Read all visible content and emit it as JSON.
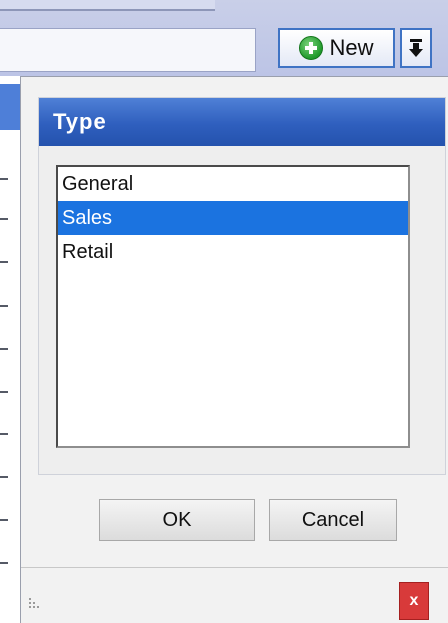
{
  "toolbar": {
    "new_label": "New",
    "new_icon": "plus-circle-icon",
    "dropdown_icon": "arrow-down-icon"
  },
  "type_panel": {
    "title": "Type",
    "items": [
      {
        "label": "General",
        "selected": false
      },
      {
        "label": "Sales",
        "selected": true
      },
      {
        "label": "Retail",
        "selected": false
      }
    ]
  },
  "dialog": {
    "ok_label": "OK",
    "cancel_label": "Cancel",
    "close_label": "x"
  },
  "colors": {
    "header_blue": "#2f5fbe",
    "selection_blue": "#1b73e0",
    "close_red": "#d83a3a",
    "new_icon_green": "#1f9a2b"
  }
}
